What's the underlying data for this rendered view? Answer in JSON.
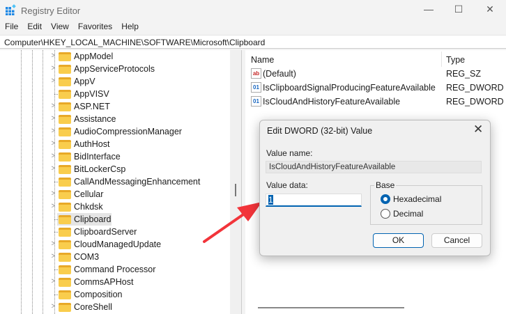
{
  "window": {
    "title": "Registry Editor",
    "minimize": "—",
    "maximize": "☐",
    "close": "✕"
  },
  "menu": [
    "File",
    "Edit",
    "View",
    "Favorites",
    "Help"
  ],
  "address": "Computer\\HKEY_LOCAL_MACHINE\\SOFTWARE\\Microsoft\\Clipboard",
  "tree": [
    {
      "label": "AppModel",
      "expandable": true
    },
    {
      "label": "AppServiceProtocols",
      "expandable": true
    },
    {
      "label": "AppV",
      "expandable": true
    },
    {
      "label": "AppVISV",
      "expandable": false
    },
    {
      "label": "ASP.NET",
      "expandable": true
    },
    {
      "label": "Assistance",
      "expandable": true
    },
    {
      "label": "AudioCompressionManager",
      "expandable": true
    },
    {
      "label": "AuthHost",
      "expandable": true
    },
    {
      "label": "BidInterface",
      "expandable": true
    },
    {
      "label": "BitLockerCsp",
      "expandable": true
    },
    {
      "label": "CallAndMessagingEnhancement",
      "expandable": false
    },
    {
      "label": "Cellular",
      "expandable": true
    },
    {
      "label": "Chkdsk",
      "expandable": true
    },
    {
      "label": "Clipboard",
      "expandable": false,
      "selected": true
    },
    {
      "label": "ClipboardServer",
      "expandable": false
    },
    {
      "label": "CloudManagedUpdate",
      "expandable": true
    },
    {
      "label": "COM3",
      "expandable": true
    },
    {
      "label": "Command Processor",
      "expandable": false
    },
    {
      "label": "CommsAPHost",
      "expandable": true
    },
    {
      "label": "Composition",
      "expandable": false
    },
    {
      "label": "CoreShell",
      "expandable": true
    }
  ],
  "values": {
    "headers": {
      "name": "Name",
      "type": "Type"
    },
    "rows": [
      {
        "name": "(Default)",
        "type": "REG_SZ",
        "icon": "string-value-icon",
        "glyph": "ab"
      },
      {
        "name": "IsClipboardSignalProducingFeatureAvailable",
        "type": "REG_DWORD",
        "icon": "binary-value-icon",
        "glyph": "01"
      },
      {
        "name": "IsCloudAndHistoryFeatureAvailable",
        "type": "REG_DWORD",
        "icon": "binary-value-icon",
        "glyph": "01"
      }
    ]
  },
  "dialog": {
    "title": "Edit DWORD (32-bit) Value",
    "close": "✕",
    "value_name_label": "Value name:",
    "value_name": "IsCloudAndHistoryFeatureAvailable",
    "value_data_label": "Value data:",
    "value_data": "1",
    "base_label": "Base",
    "hex_label": "Hexadecimal",
    "dec_label": "Decimal",
    "base_selected": "Hexadecimal",
    "ok": "OK",
    "cancel": "Cancel"
  },
  "colors": {
    "accent": "#0063b1",
    "arrow": "#f2343a",
    "folder": "#f9cd4d"
  }
}
